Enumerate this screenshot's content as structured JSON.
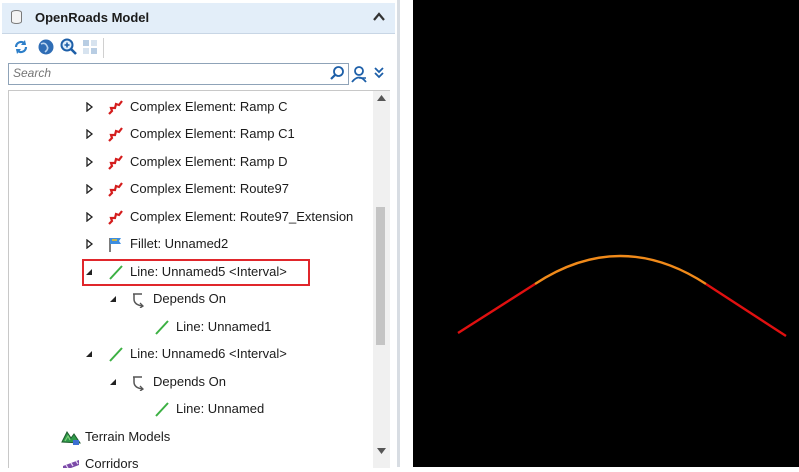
{
  "panel": {
    "title": "OpenRoads Model",
    "search_placeholder": "Search"
  },
  "tree": {
    "rows": [
      {
        "label": "Complex Element: Ramp C",
        "expander": "collapsed",
        "icon": "complex-element-icon"
      },
      {
        "label": "Complex Element: Ramp C1",
        "expander": "collapsed",
        "icon": "complex-element-icon"
      },
      {
        "label": "Complex Element: Ramp D",
        "expander": "collapsed",
        "icon": "complex-element-icon"
      },
      {
        "label": "Complex Element: Route97",
        "expander": "collapsed",
        "icon": "complex-element-icon"
      },
      {
        "label": "Complex Element: Route97_Extension",
        "expander": "collapsed",
        "icon": "complex-element-icon"
      },
      {
        "label": "Fillet: Unnamed2",
        "expander": "collapsed",
        "icon": "fillet-icon"
      },
      {
        "label": "Line: Unnamed5 <Interval>",
        "expander": "expanded",
        "icon": "line-icon",
        "highlighted": true
      },
      {
        "label": "Depends On",
        "expander": "expanded",
        "icon": "depends-on-icon"
      },
      {
        "label": "Line: Unnamed1",
        "expander": "none",
        "icon": "line-icon"
      },
      {
        "label": "Line: Unnamed6 <Interval>",
        "expander": "expanded",
        "icon": "line-icon"
      },
      {
        "label": "Depends On",
        "expander": "expanded",
        "icon": "depends-on-icon"
      },
      {
        "label": "Line: Unnamed",
        "expander": "none",
        "icon": "line-icon"
      },
      {
        "label": "Terrain Models",
        "expander": "none",
        "icon": "terrain-models-icon"
      },
      {
        "label": "Corridors",
        "expander": "none",
        "icon": "corridors-icon"
      }
    ]
  },
  "viewport": {
    "background": "#000000",
    "tangent_color": "#e01010",
    "curve_color": "#f08a1a"
  }
}
